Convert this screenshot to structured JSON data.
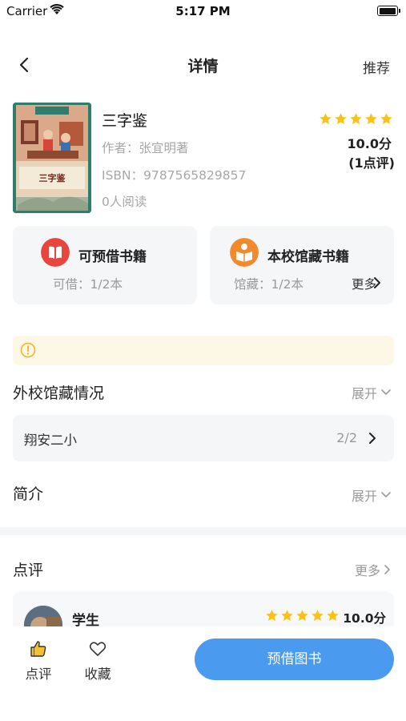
{
  "status_bar": {
    "carrier": "Carrier",
    "time": "5:17 PM"
  },
  "nav": {
    "title": "详情",
    "right_action": "推荐",
    "back_icon": "chevron-left-icon"
  },
  "book": {
    "title": "三字鉴",
    "author_line": "作者：张宜明著",
    "isbn_line": "ISBN：9787565829857",
    "readers_line": "0人阅读",
    "cover_title": "三字鉴",
    "rating_stars": 5,
    "score": "10.0分",
    "review_count": "(1点评)",
    "star_color": "#f8c21b"
  },
  "cards": {
    "borrowable": {
      "title": "可预借书籍",
      "sub": "可借：1/2本",
      "icon": "book-icon",
      "color": "#e8453c"
    },
    "school": {
      "title": "本校馆藏书籍",
      "sub": "馆藏：1/2本",
      "more": "更多",
      "icon": "reading-icon",
      "color": "#f08a2c"
    }
  },
  "notice": {
    "icon": "info-icon",
    "color": "#f0b429"
  },
  "other_schools": {
    "title": "外校馆藏情况",
    "expand": "展开",
    "rows": [
      {
        "name": "翔安二小",
        "count": "2/2"
      }
    ]
  },
  "intro": {
    "title": "简介",
    "expand": "展开"
  },
  "reviews": {
    "title": "点评",
    "more": "更多",
    "items": [
      {
        "name": "学生",
        "stars": 5,
        "score": "10.0分"
      }
    ]
  },
  "bottom": {
    "review_label": "点评",
    "favorite_label": "收藏",
    "primary_label": "预借图书",
    "primary_color": "#4a9af0"
  }
}
